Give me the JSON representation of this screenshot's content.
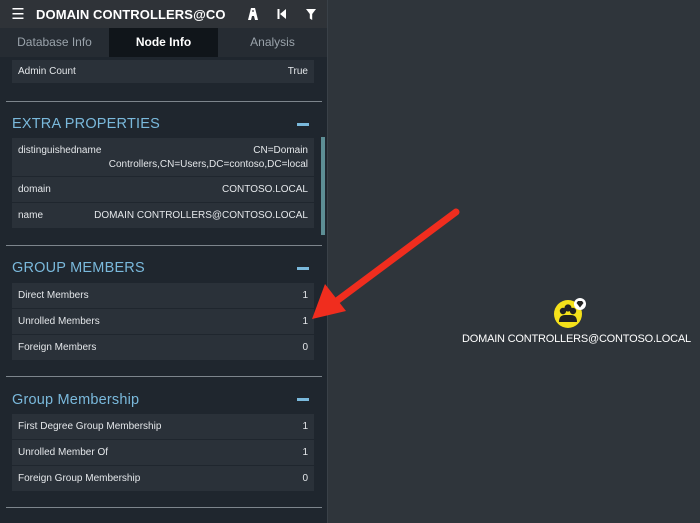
{
  "search": {
    "value": "DOMAIN CONTROLLERS@CONTOSO.LOCAL"
  },
  "tabs": [
    {
      "label": "Database Info"
    },
    {
      "label": "Node Info"
    },
    {
      "label": "Analysis"
    }
  ],
  "overview": {
    "admin_count_label": "Admin Count",
    "admin_count_value": "True"
  },
  "extra_properties": {
    "title": "EXTRA PROPERTIES",
    "rows": [
      {
        "key": "distinguishedname",
        "value_line1": "CN=Domain",
        "value_line2": "Controllers,CN=Users,DC=contoso,DC=local"
      },
      {
        "key": "domain",
        "value": "CONTOSO.LOCAL"
      },
      {
        "key": "name",
        "value": "DOMAIN CONTROLLERS@CONTOSO.LOCAL"
      }
    ]
  },
  "group_members": {
    "title": "GROUP MEMBERS",
    "rows": [
      {
        "key": "Direct Members",
        "value": "1"
      },
      {
        "key": "Unrolled Members",
        "value": "1"
      },
      {
        "key": "Foreign Members",
        "value": "0"
      }
    ]
  },
  "group_membership": {
    "title": "Group Membership",
    "rows": [
      {
        "key": "First Degree Group Membership",
        "value": "1"
      },
      {
        "key": "Unrolled Member Of",
        "value": "1"
      },
      {
        "key": "Foreign Group Membership",
        "value": "0"
      }
    ]
  },
  "graph": {
    "node_label": "DOMAIN CONTROLLERS@CONTOSO.LOCAL",
    "node_icon": "group-icon",
    "highvalue_icon": "diamond-icon"
  },
  "colors": {
    "accent": "#7ab9dc",
    "arrow": "#f02d1e",
    "node": "#f5e11a"
  }
}
